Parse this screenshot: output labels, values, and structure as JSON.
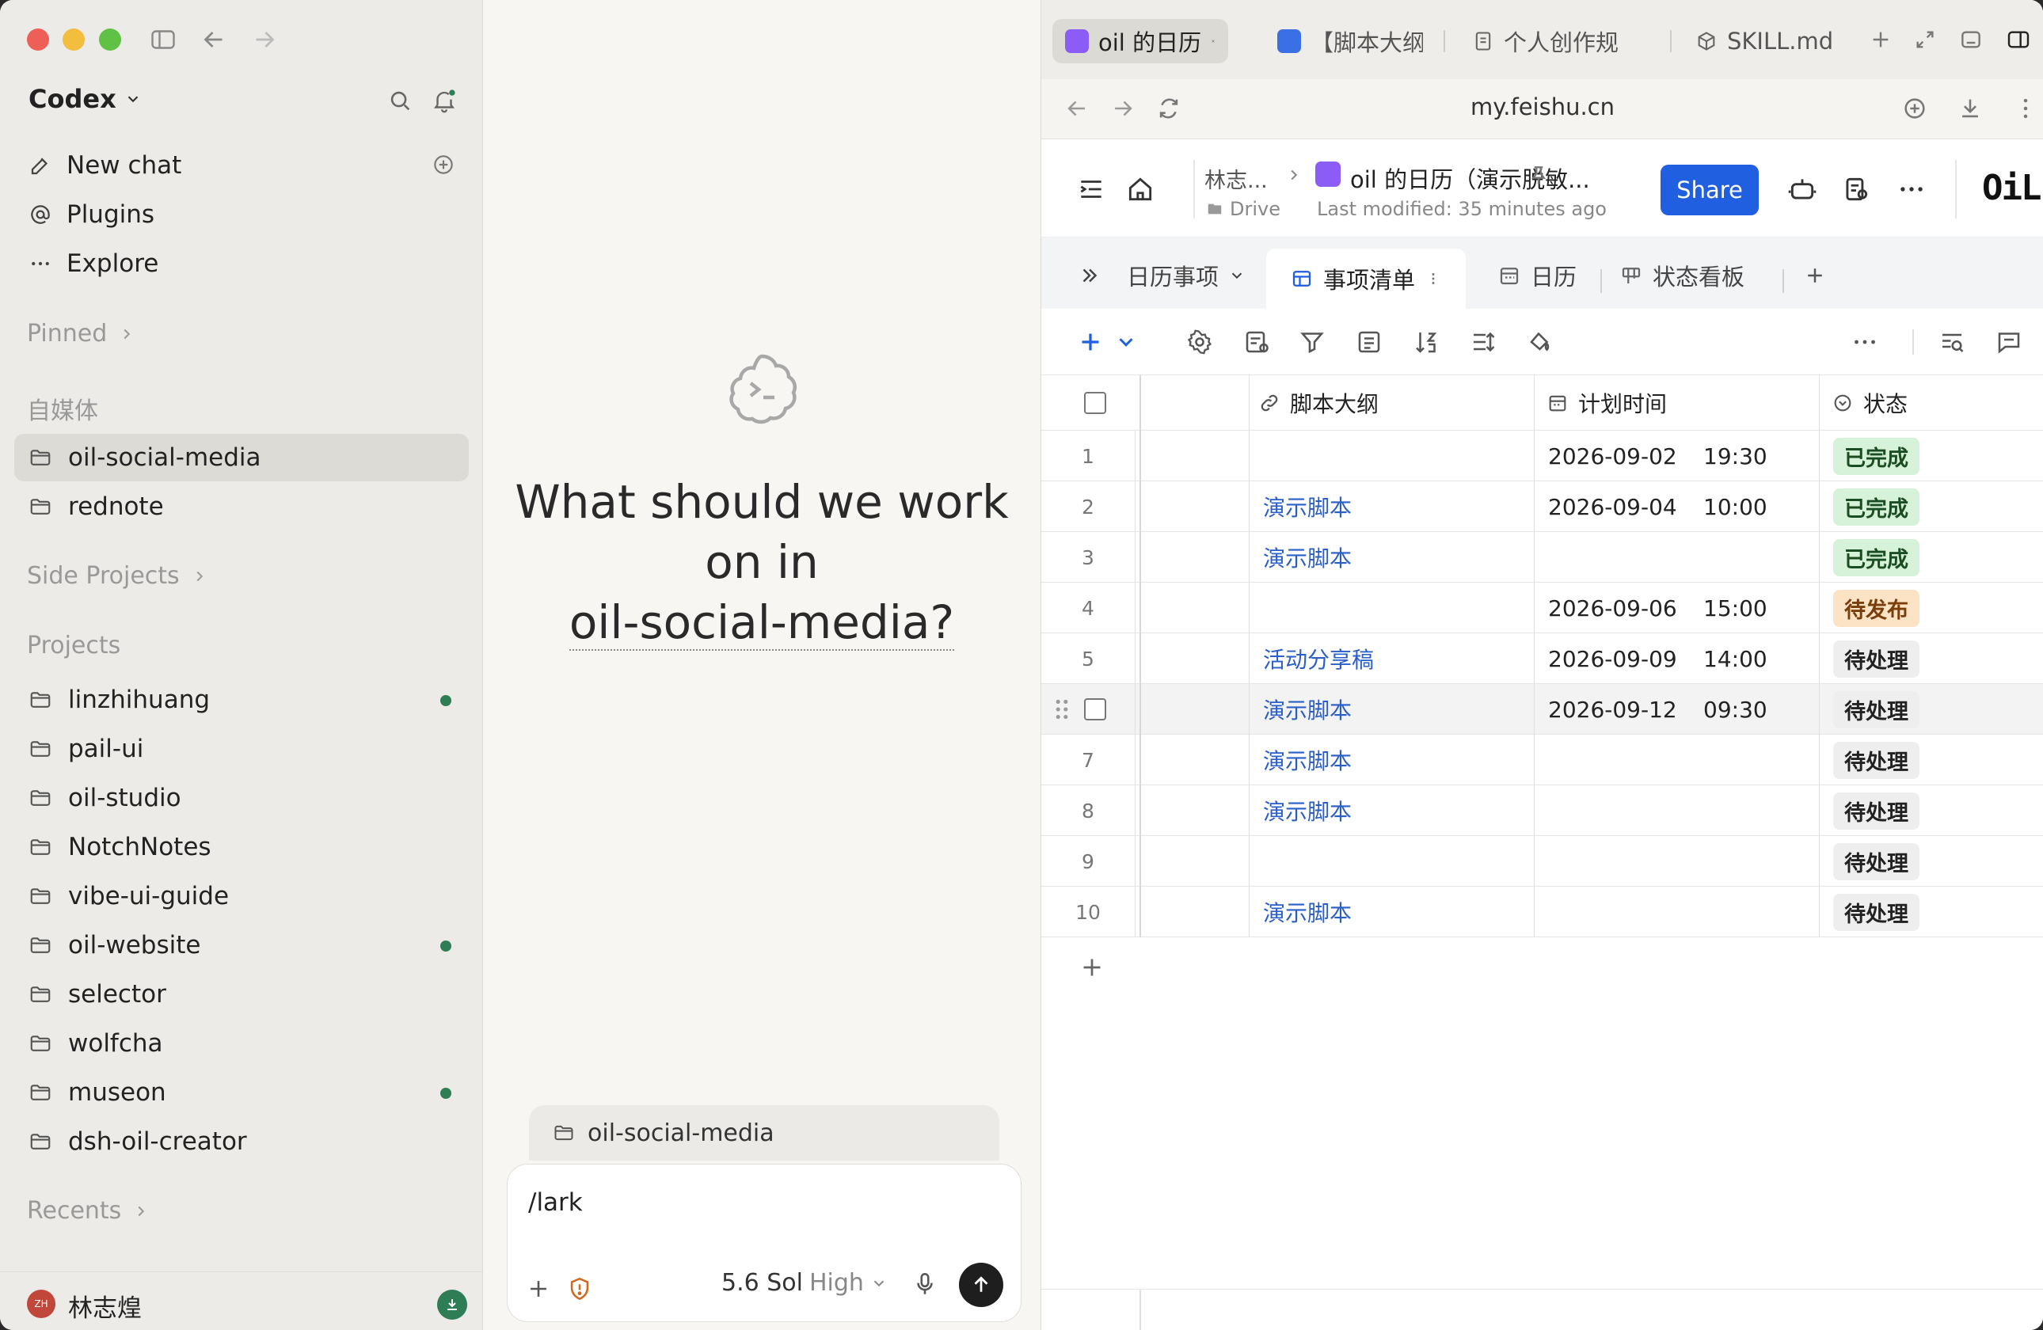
{
  "sidebar": {
    "app_title": "Codex",
    "nav": [
      {
        "label": "New chat",
        "icon": "edit-icon"
      },
      {
        "label": "Plugins",
        "icon": "at-icon"
      },
      {
        "label": "Explore",
        "icon": "ellipsis-icon"
      }
    ],
    "pinned_label": "Pinned",
    "group_label": "自媒体",
    "group_items": [
      "oil-social-media",
      "rednote"
    ],
    "side_projects_label": "Side Projects",
    "projects_label": "Projects",
    "projects": [
      {
        "name": "linzhihuang",
        "dot": true
      },
      {
        "name": "pail-ui",
        "dot": false
      },
      {
        "name": "oil-studio",
        "dot": false
      },
      {
        "name": "NotchNotes",
        "dot": false
      },
      {
        "name": "vibe-ui-guide",
        "dot": false
      },
      {
        "name": "oil-website",
        "dot": true
      },
      {
        "name": "selector",
        "dot": false
      },
      {
        "name": "wolfcha",
        "dot": false
      },
      {
        "name": "museon",
        "dot": true
      },
      {
        "name": "dsh-oil-creator",
        "dot": false
      }
    ],
    "recents_label": "Recents",
    "user": {
      "avatar_text": "ZH",
      "name": "林志煌"
    }
  },
  "chat": {
    "heading_line1": "What should we work",
    "heading_line2": "on in",
    "heading_project": "oil-social-media?",
    "context_chip": "oil-social-media",
    "composer_value": "/lark",
    "model": "5.6 Sol",
    "level": "High"
  },
  "browser": {
    "tabs": [
      {
        "label": "oil 的日历",
        "favicon": "purple"
      },
      {
        "label": "【脚本大纲",
        "favicon": "blue"
      },
      {
        "label": "个人创作规",
        "favicon": "doc"
      },
      {
        "label": "SKILL.md",
        "favicon": "cube"
      }
    ],
    "url": "my.feishu.cn",
    "doc": {
      "breadcrumb_parent": "林志...",
      "breadcrumb_location": "Drive",
      "title": "oil 的日历（演示脱敏...",
      "modified": "Last modified: 35 minutes ago",
      "share_label": "Share",
      "brand": "OiL"
    },
    "views": {
      "table_group": "日历事项",
      "active_view": "事项清单",
      "other_views": [
        "日历",
        "状态看板"
      ]
    },
    "columns": [
      "脚本大纲",
      "计划时间",
      "状态"
    ],
    "rows": [
      {
        "n": "1",
        "script": "",
        "date": "2026-09-02",
        "time": "19:30",
        "status": "已完成",
        "kind": "done"
      },
      {
        "n": "2",
        "script": "演示脚本",
        "date": "2026-09-04",
        "time": "10:00",
        "status": "已完成",
        "kind": "done"
      },
      {
        "n": "3",
        "script": "演示脚本",
        "date": "",
        "time": "",
        "status": "已完成",
        "kind": "done"
      },
      {
        "n": "4",
        "script": "",
        "date": "2026-09-06",
        "time": "15:00",
        "status": "待发布",
        "kind": "pub"
      },
      {
        "n": "5",
        "script": "活动分享稿",
        "date": "2026-09-09",
        "time": "14:00",
        "status": "待处理",
        "kind": "todo"
      },
      {
        "n": "",
        "script": "演示脚本",
        "date": "2026-09-12",
        "time": "09:30",
        "status": "待处理",
        "kind": "todo",
        "hover": true
      },
      {
        "n": "7",
        "script": "演示脚本",
        "date": "",
        "time": "",
        "status": "待处理",
        "kind": "todo"
      },
      {
        "n": "8",
        "script": "演示脚本",
        "date": "",
        "time": "",
        "status": "待处理",
        "kind": "todo"
      },
      {
        "n": "9",
        "script": "",
        "date": "",
        "time": "",
        "status": "待处理",
        "kind": "todo"
      },
      {
        "n": "10",
        "script": "演示脚本",
        "date": "",
        "time": "",
        "status": "待处理",
        "kind": "todo"
      }
    ]
  },
  "colors": {
    "accent_blue": "#1f5fe0",
    "status_done_bg": "#d6f2d8",
    "status_pub_bg": "#fde3c5",
    "status_todo_bg": "#eeeeee",
    "project_dot": "#2e7d55"
  }
}
